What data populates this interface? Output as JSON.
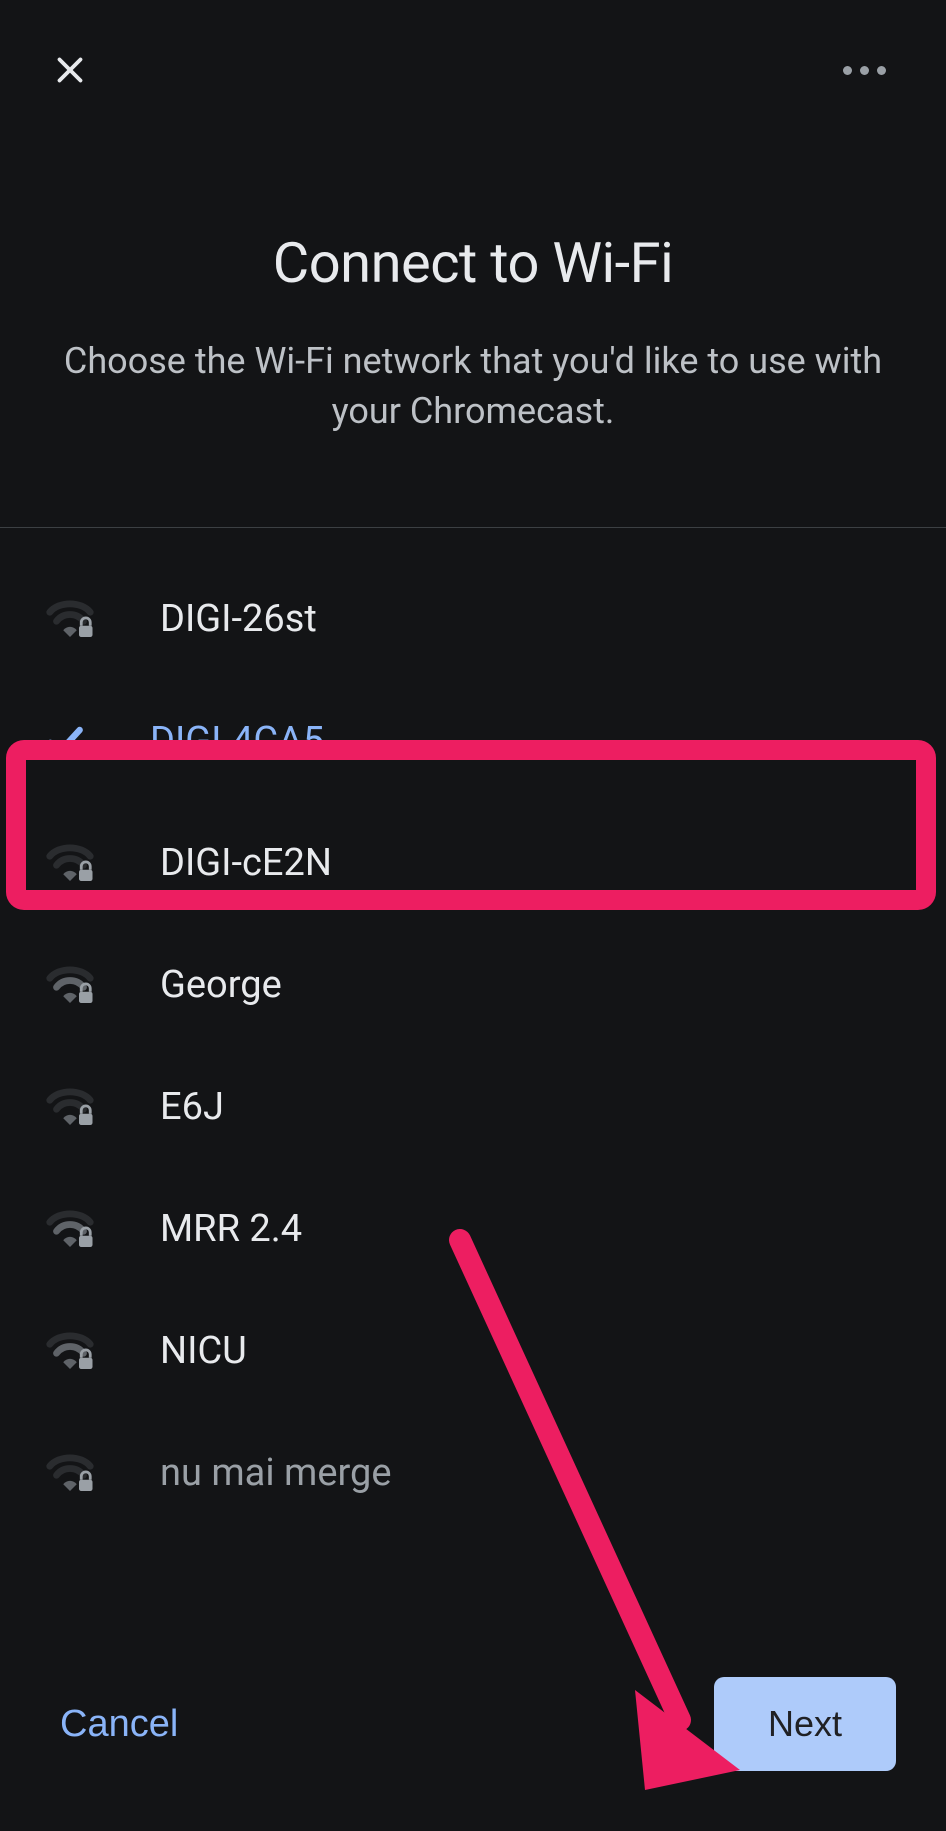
{
  "title": "Connect to Wi-Fi",
  "subtitle": "Choose the Wi-Fi network that you'd like to use with your Chromecast.",
  "networks": [
    {
      "name": "DIGI-26st",
      "selected": false,
      "signal": "weak"
    },
    {
      "name": "DIGI-4CA5",
      "selected": true,
      "signal": "none"
    },
    {
      "name": "DIGI-cE2N",
      "selected": false,
      "signal": "weak"
    },
    {
      "name": "George",
      "selected": false,
      "signal": "medium"
    },
    {
      "name": "E6J",
      "selected": false,
      "signal": "weak"
    },
    {
      "name": "MRR 2.4",
      "selected": false,
      "signal": "medium"
    },
    {
      "name": "NICU",
      "selected": false,
      "signal": "medium"
    },
    {
      "name": "nu mai merge",
      "selected": false,
      "signal": "weak",
      "partial": true
    }
  ],
  "footer": {
    "cancel": "Cancel",
    "next": "Next"
  }
}
